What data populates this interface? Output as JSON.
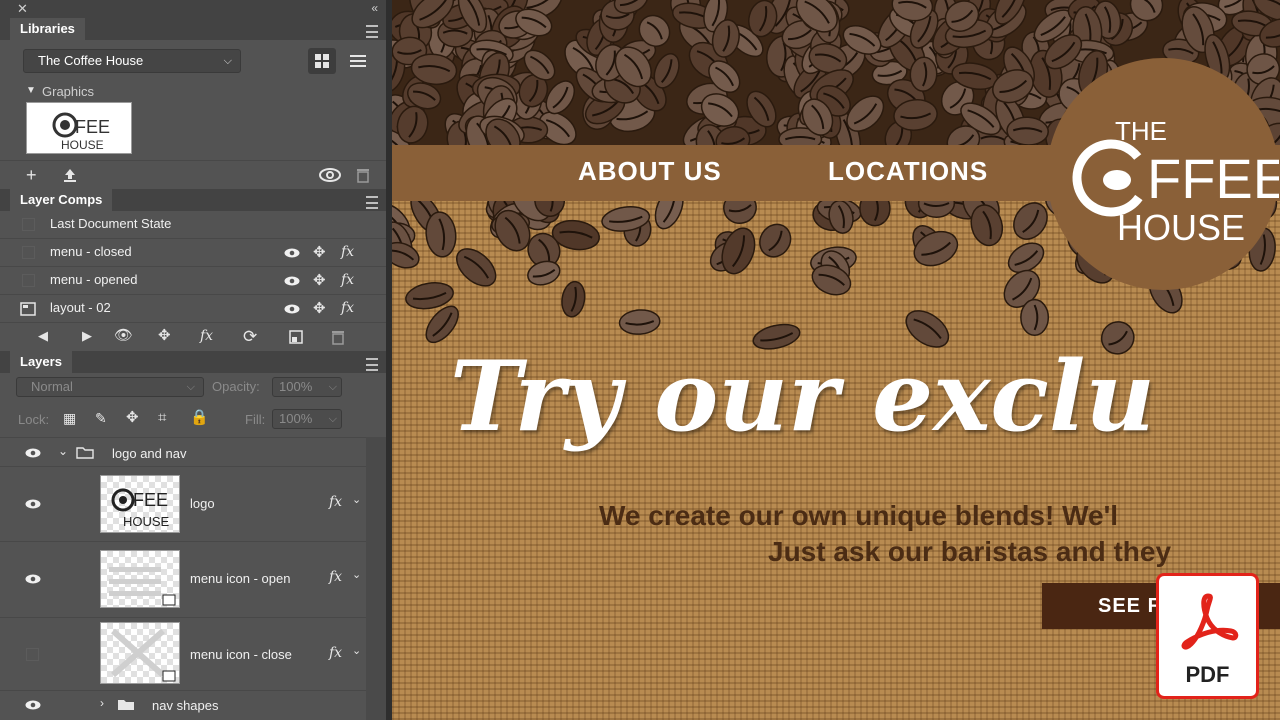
{
  "panel": {
    "libraries": {
      "tab_title": "Libraries",
      "library_select": "The Coffee House",
      "section": "Graphics"
    },
    "layer_comps": {
      "tab_title": "Layer Comps",
      "items": [
        {
          "name": "Last Document State"
        },
        {
          "name": "menu - closed"
        },
        {
          "name": "menu - opened"
        },
        {
          "name": "layout - 02"
        }
      ]
    },
    "layers": {
      "tab_title": "Layers",
      "blend_mode": "Normal",
      "opacity_label": "Opacity:",
      "opacity_value": "100%",
      "lock_label": "Lock:",
      "fill_label": "Fill:",
      "fill_value": "100%",
      "items": [
        {
          "name": "logo and nav",
          "type": "group",
          "visible": true
        },
        {
          "name": "logo",
          "type": "layer",
          "visible": true
        },
        {
          "name": "menu icon - open",
          "type": "layer",
          "visible": true
        },
        {
          "name": "menu icon - close",
          "type": "layer",
          "visible": false
        },
        {
          "name": "nav shapes",
          "type": "group",
          "visible": true
        }
      ]
    }
  },
  "canvas": {
    "nav": [
      "ABOUT US",
      "LOCATIONS"
    ],
    "logo": {
      "line1": "THE",
      "line2": "FFEE",
      "line3": "HOUSE"
    },
    "headline": "Try our exclu",
    "subline1": "We create our own unique blends!  We'l",
    "subline2": "Just ask our baristas and they",
    "cta": "SEE F"
  },
  "badge": {
    "label": "PDF",
    "color": "#e2231a"
  },
  "colors": {
    "nav_brown": "#8a6038",
    "text_brown": "#4b2c14",
    "cta_brown": "#4a2612",
    "panel_bg": "#535353"
  }
}
